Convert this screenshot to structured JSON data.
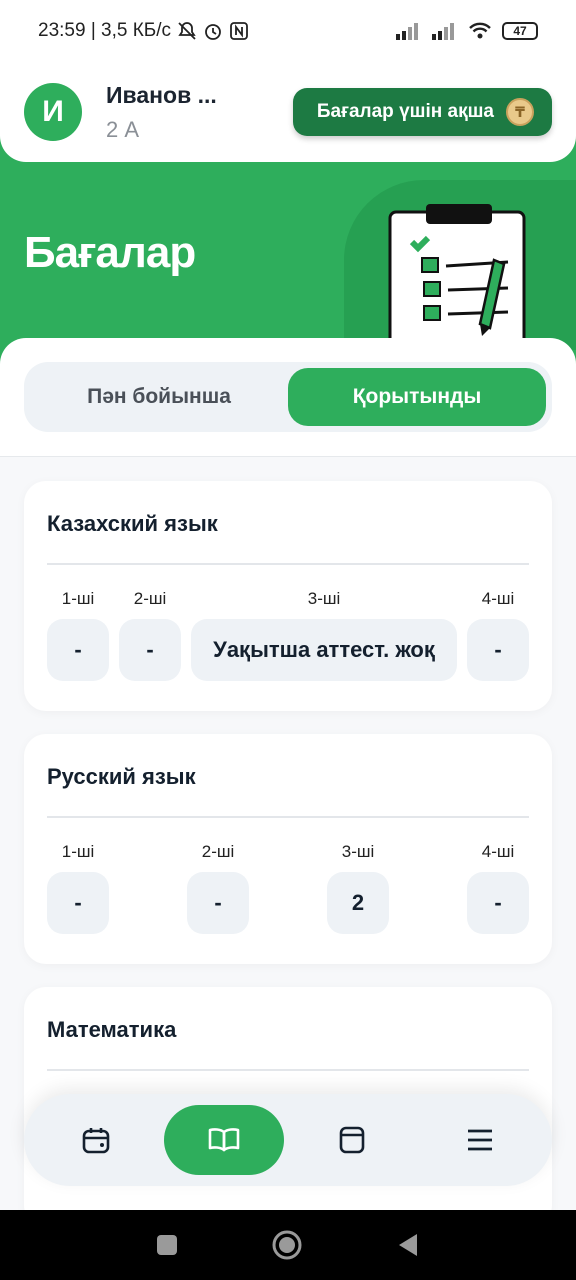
{
  "status_bar": {
    "time_speed": "23:59 | 3,5 КБ/с",
    "battery": "47"
  },
  "header": {
    "avatar_letter": "И",
    "user_name": "Иванов ...",
    "user_class": "2 А",
    "money_button_label": "Бағалар үшін ақша",
    "coin_symbol": "₸"
  },
  "banner": {
    "title": "Бағалар"
  },
  "tabs": [
    {
      "label": "Пән бойынша",
      "active": false
    },
    {
      "label": "Қорытынды",
      "active": true
    }
  ],
  "subjects": [
    {
      "name": "Казахский язык",
      "quarters": [
        {
          "label": "1-ші",
          "value": "-"
        },
        {
          "label": "2-ші",
          "value": "-"
        },
        {
          "label": "3-ші",
          "value": "Уақытша аттест. жоқ"
        },
        {
          "label": "4-ші",
          "value": "-"
        }
      ]
    },
    {
      "name": "Русский язык",
      "quarters": [
        {
          "label": "1-ші",
          "value": "-"
        },
        {
          "label": "2-ші",
          "value": "-"
        },
        {
          "label": "3-ші",
          "value": "2"
        },
        {
          "label": "4-ші",
          "value": "-"
        }
      ]
    },
    {
      "name": "Математика",
      "quarters": []
    }
  ],
  "bottom_nav": [
    {
      "icon": "calendar-icon",
      "active": false
    },
    {
      "icon": "book-icon",
      "active": true
    },
    {
      "icon": "notebook-icon",
      "active": false
    },
    {
      "icon": "menu-icon",
      "active": false
    }
  ],
  "colors": {
    "brand_green": "#2eae5c",
    "dark_green": "#1d7a43",
    "surface": "#eef2f6"
  }
}
